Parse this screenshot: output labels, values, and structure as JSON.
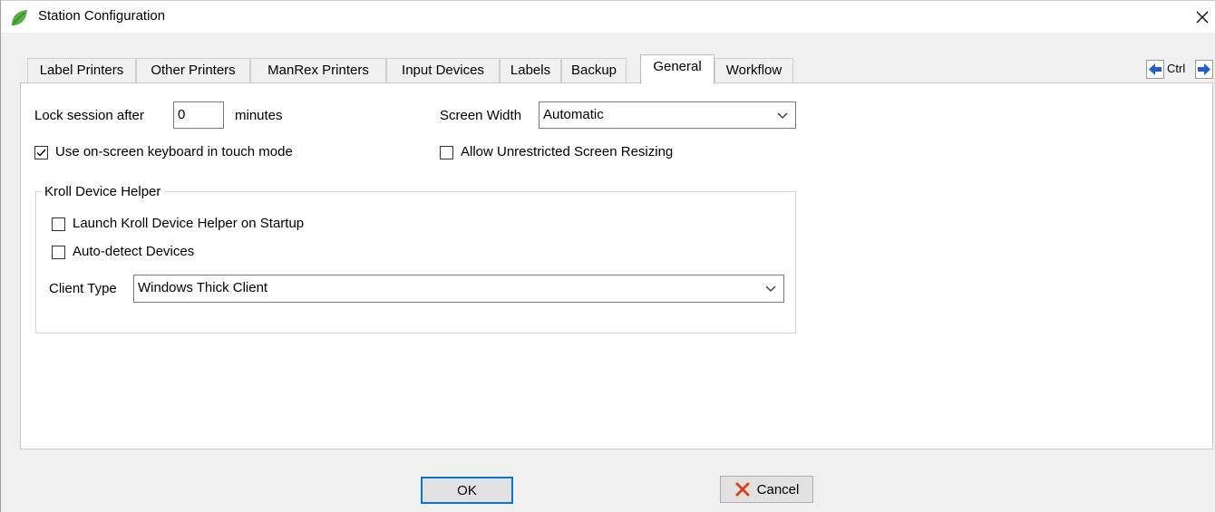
{
  "window": {
    "title": "Station Configuration"
  },
  "tabs": [
    "Label Printers",
    "Other Printers",
    "ManRex Printers",
    "Input Devices",
    "Labels",
    "Backup",
    "General",
    "Workflow"
  ],
  "active_tab": "General",
  "nav": {
    "ctrl_label": "Ctrl"
  },
  "general": {
    "lock_label": "Lock session after",
    "lock_value": "0",
    "lock_unit": "minutes",
    "screen_width_label": "Screen Width",
    "screen_width_value": "Automatic",
    "onscreen_keyboard_label": "Use on-screen keyboard in touch mode",
    "onscreen_keyboard_checked": true,
    "unrestricted_resize_label": "Allow Unrestricted Screen Resizing",
    "unrestricted_resize_checked": false
  },
  "kroll": {
    "group_title": "Kroll Device Helper",
    "launch_label": "Launch Kroll Device Helper on Startup",
    "launch_checked": false,
    "autodetect_label": "Auto-detect Devices",
    "autodetect_checked": false,
    "client_type_label": "Client Type",
    "client_type_value": "Windows Thick Client"
  },
  "buttons": {
    "ok": "OK",
    "cancel": "Cancel"
  },
  "colors": {
    "accent": "#0078d7",
    "leaf": "#4caf50",
    "cancel_x": "#d9421c",
    "arrow": "#1f5fd6"
  },
  "icons": {
    "app": "leaf-icon",
    "close": "close-icon",
    "prev": "arrow-left-icon",
    "next": "arrow-right-icon",
    "cancel": "x-icon"
  }
}
